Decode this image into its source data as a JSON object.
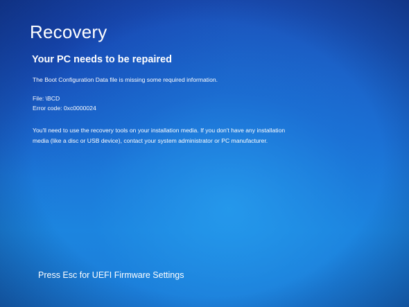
{
  "screen": {
    "title": "Recovery",
    "subtitle": "Your PC needs to be repaired",
    "message": "The Boot Configuration Data file is missing some required information.",
    "file_line": "File: \\BCD",
    "error_line": "Error code: 0xc0000024",
    "instructions": "You'll need to use the recovery tools on your installation media. If you don't have any installation media (like a disc or USB device), contact your system administrator or PC manufacturer.",
    "footer_hint": "Press Esc for UEFI Firmware Settings"
  },
  "colors": {
    "background": "#1a6ad0",
    "text": "#ffffff"
  }
}
